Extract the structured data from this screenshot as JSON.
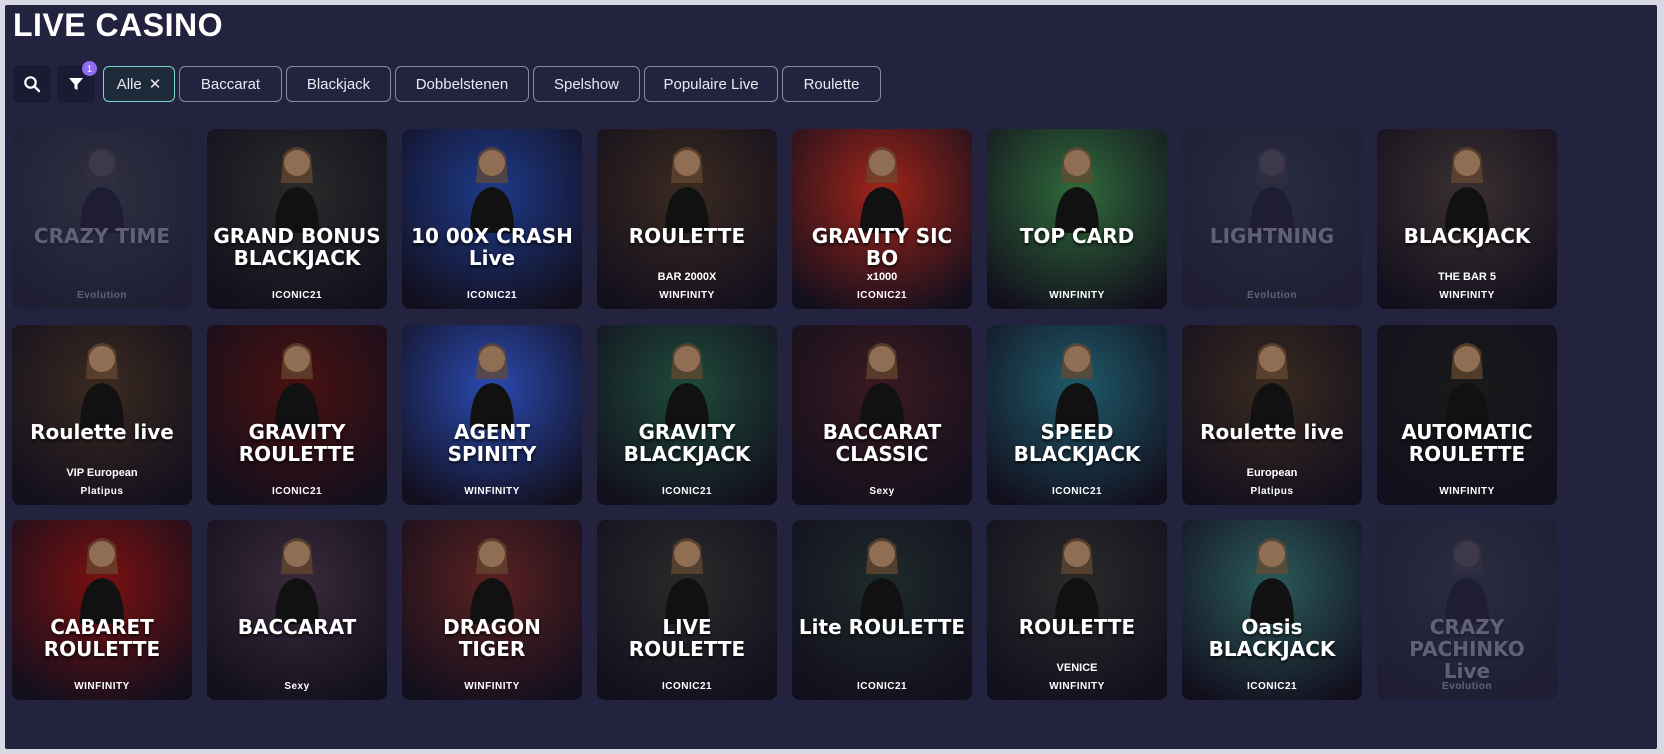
{
  "header": {
    "title": "LIVE CASINO"
  },
  "toolbar": {
    "search_icon": "search-icon",
    "filter_icon": "filter-icon",
    "filter_count": "1",
    "chips": [
      {
        "label": "Alle",
        "active": true
      },
      {
        "label": "Baccarat"
      },
      {
        "label": "Blackjack"
      },
      {
        "label": "Dobbelstenen"
      },
      {
        "label": "Spelshow"
      },
      {
        "label": "Populaire Live"
      },
      {
        "label": "Roulette"
      }
    ]
  },
  "games": [
    {
      "title": "CRAZY TIME",
      "provider": "Evolution",
      "dim": true,
      "bg": "#3a5a3a"
    },
    {
      "title": "GRAND BONUS BLACKJACK",
      "provider": "ICONIC21",
      "bg": "#2a2a2a"
    },
    {
      "title": "10 00X CRASH Live",
      "provider": "ICONIC21",
      "bg": "#1e3a8a"
    },
    {
      "title": "ROULETTE",
      "sub": "BAR 2000X",
      "provider": "WINFINITY",
      "bg": "#3b2a20"
    },
    {
      "title": "GRAVITY SIC BO",
      "sub": "x1000",
      "provider": "ICONIC21",
      "bg": "#a02418"
    },
    {
      "title": "TOP CARD",
      "provider": "WINFINITY",
      "bg": "#2f6a3a"
    },
    {
      "title": "LIGHTNING",
      "provider": "Evolution",
      "dim": true,
      "bg": "#2a4a4a"
    },
    {
      "title": "BLACKJACK",
      "sub": "THE BAR 5",
      "provider": "WINFINITY",
      "bg": "#3a3030"
    },
    {
      "title": "Roulette live",
      "sub": "VIP European",
      "provider": "Platipus",
      "bg": "#3a2a20"
    },
    {
      "title": "GRAVITY ROULETTE",
      "provider": "ICONIC21",
      "bg": "#4a1010"
    },
    {
      "title": "AGENT SPINITY",
      "provider": "WINFINITY",
      "bg": "#2a4ab0"
    },
    {
      "title": "GRAVITY BLACKJACK",
      "provider": "ICONIC21",
      "bg": "#1e4a3a"
    },
    {
      "title": "BACCARAT CLASSIC",
      "provider": "Sexy",
      "bg": "#3a1a20"
    },
    {
      "title": "SPEED BLACKJACK",
      "provider": "ICONIC21",
      "bg": "#1e5a6a"
    },
    {
      "title": "Roulette live",
      "sub": "European",
      "provider": "Platipus",
      "bg": "#3a2a20"
    },
    {
      "title": "AUTOMATIC ROULETTE",
      "provider": "WINFINITY",
      "bg": "#1a1a1a"
    },
    {
      "title": "CABARET ROULETTE",
      "provider": "WINFINITY",
      "bg": "#7a1010"
    },
    {
      "title": "BACCARAT",
      "provider": "Sexy",
      "bg": "#3a2a3a"
    },
    {
      "title": "DRAGON TIGER",
      "provider": "WINFINITY",
      "bg": "#5a2020"
    },
    {
      "title": "LIVE ROULETTE",
      "provider": "ICONIC21",
      "bg": "#2a2a2a"
    },
    {
      "title": "Lite ROULETTE",
      "provider": "ICONIC21",
      "bg": "#1e2a2a"
    },
    {
      "title": "ROULETTE",
      "sub": "VENICE",
      "provider": "WINFINITY",
      "bg": "#2a2a2a"
    },
    {
      "title": "Oasis BLACKJACK",
      "provider": "ICONIC21",
      "bg": "#2a5a5a"
    },
    {
      "title": "CRAZY PACHINKO Live",
      "provider": "Evolution",
      "dim": true,
      "bg": "#2a4a3a"
    }
  ]
}
